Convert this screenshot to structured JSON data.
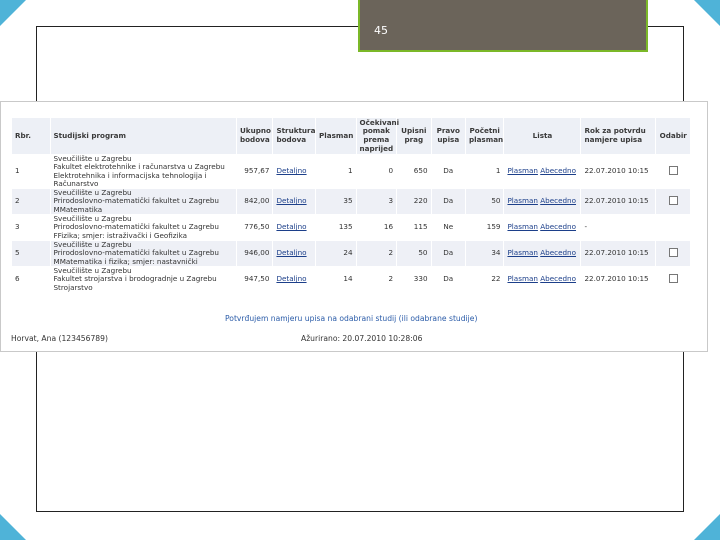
{
  "slide": {
    "number": "45"
  },
  "table": {
    "headers": {
      "rbr": "Rbr.",
      "program": "Studijski program",
      "ukupno": "Ukupno bodova",
      "struktura": "Struktura bodova",
      "plasman": "Plasman",
      "ocekivani": "Očekivani pomak prema naprijed",
      "upisni": "Upisni prag",
      "pravo": "Pravo upisa",
      "pocetni": "Početni plasman",
      "lista": "Lista",
      "rok": "Rok za potvrdu namjere upisa",
      "odabir": "Odabir"
    },
    "rows": [
      {
        "rbr": "1",
        "line1": "Sveučilište u Zagrebu",
        "line2": "Fakultet elektrotehnike i računarstva u Zagrebu",
        "line3": "Elektrotehnika i informacijska tehnologija i Računarstvo",
        "ukupno": "957,67",
        "detaljno": "Detaljno",
        "plasman": "1",
        "pomak": "0",
        "prag": "650",
        "pravo": "Da",
        "pocetni": "1",
        "lista_plasman": "Plasman",
        "lista_abecedno": "Abecedno",
        "rok": "22.07.2010 10:15",
        "has_checkbox": true
      },
      {
        "rbr": "2",
        "line1": "Sveučilište u Zagrebu",
        "line2": "Prirodoslovno-matematički fakultet u Zagrebu",
        "line3": "MMatematika",
        "ukupno": "842,00",
        "detaljno": "Detaljno",
        "plasman": "35",
        "pomak": "3",
        "prag": "220",
        "pravo": "Da",
        "pocetni": "50",
        "lista_plasman": "Plasman",
        "lista_abecedno": "Abecedno",
        "rok": "22.07.2010 10:15",
        "has_checkbox": true
      },
      {
        "rbr": "3",
        "line1": "Sveučilište u Zagrebu",
        "line2": "Prirodoslovno-matematički fakultet u Zagrebu",
        "line3": "FFizika; smjer: istraživački i Geofizika",
        "ukupno": "776,50",
        "detaljno": "Detaljno",
        "plasman": "135",
        "pomak": "16",
        "prag": "115",
        "pravo": "Ne",
        "pocetni": "159",
        "lista_plasman": "Plasman",
        "lista_abecedno": "Abecedno",
        "rok": "-",
        "has_checkbox": false
      },
      {
        "rbr": "5",
        "line1": "Sveučilište u Zagrebu",
        "line2": "Prirodoslovno-matematički fakultet u Zagrebu",
        "line3": "MMatematika i fizika; smjer: nastavnički",
        "ukupno": "946,00",
        "detaljno": "Detaljno",
        "plasman": "24",
        "pomak": "2",
        "prag": "50",
        "pravo": "Da",
        "pocetni": "34",
        "lista_plasman": "Plasman",
        "lista_abecedno": "Abecedno",
        "rok": "22.07.2010 10:15",
        "has_checkbox": true
      },
      {
        "rbr": "6",
        "line1": "Sveučilište u Zagrebu",
        "line2": "Fakultet strojarstva i brodogradnje u Zagrebu",
        "line3": "Strojarstvo",
        "ukupno": "947,50",
        "detaljno": "Detaljno",
        "plasman": "14",
        "pomak": "2",
        "prag": "330",
        "pravo": "Da",
        "pocetni": "22",
        "lista_plasman": "Plasman",
        "lista_abecedno": "Abecedno",
        "rok": "22.07.2010 10:15",
        "has_checkbox": true
      }
    ]
  },
  "confirm_link": "Potvrđujem namjeru upisa na odabrani studij (ili odabrane studije)",
  "footer": {
    "user": "Horvat, Ana (123456789)",
    "updated": "Ažurirano: 20.07.2010 10:28:06"
  },
  "colors": {
    "accent_blue": "#4fb3d8",
    "slide_box": "#6b645a",
    "slide_border": "#7bb828",
    "link": "#1c3f8a"
  }
}
